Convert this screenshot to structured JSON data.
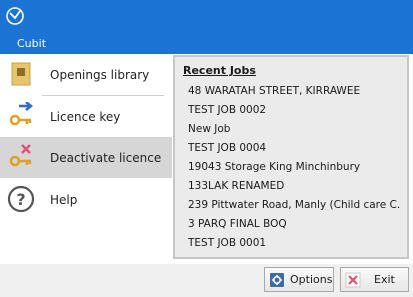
{
  "app": {
    "title": "Cubit"
  },
  "menu": {
    "tab_label": "Cubit"
  },
  "nav": {
    "items": [
      {
        "label": "Openings library",
        "icon": "openings-library-icon"
      },
      {
        "label": "Licence key",
        "icon": "key-arrow-icon"
      },
      {
        "label": "Deactivate licence",
        "icon": "key-cross-icon",
        "selected": true
      },
      {
        "label": "Help",
        "icon": "help-icon"
      }
    ]
  },
  "recent": {
    "title": "Recent Jobs",
    "jobs": [
      "48 WARATAH STREET, KIRRAWEE",
      "TEST JOB 0002",
      "New Job",
      "TEST JOB 0004",
      "19043 Storage King Minchinbury",
      "133LAK  RENAMED",
      "239 Pittwater Road, Manly (Child care C...",
      "3 PARQ FINAL BOQ",
      "TEST JOB 0001"
    ]
  },
  "footer": {
    "options_label": "Options",
    "exit_label": "Exit"
  },
  "colors": {
    "title_bar": "#1b74d4",
    "selected_item": "#d6d6d6",
    "recent_panel": "#ebebeb"
  }
}
